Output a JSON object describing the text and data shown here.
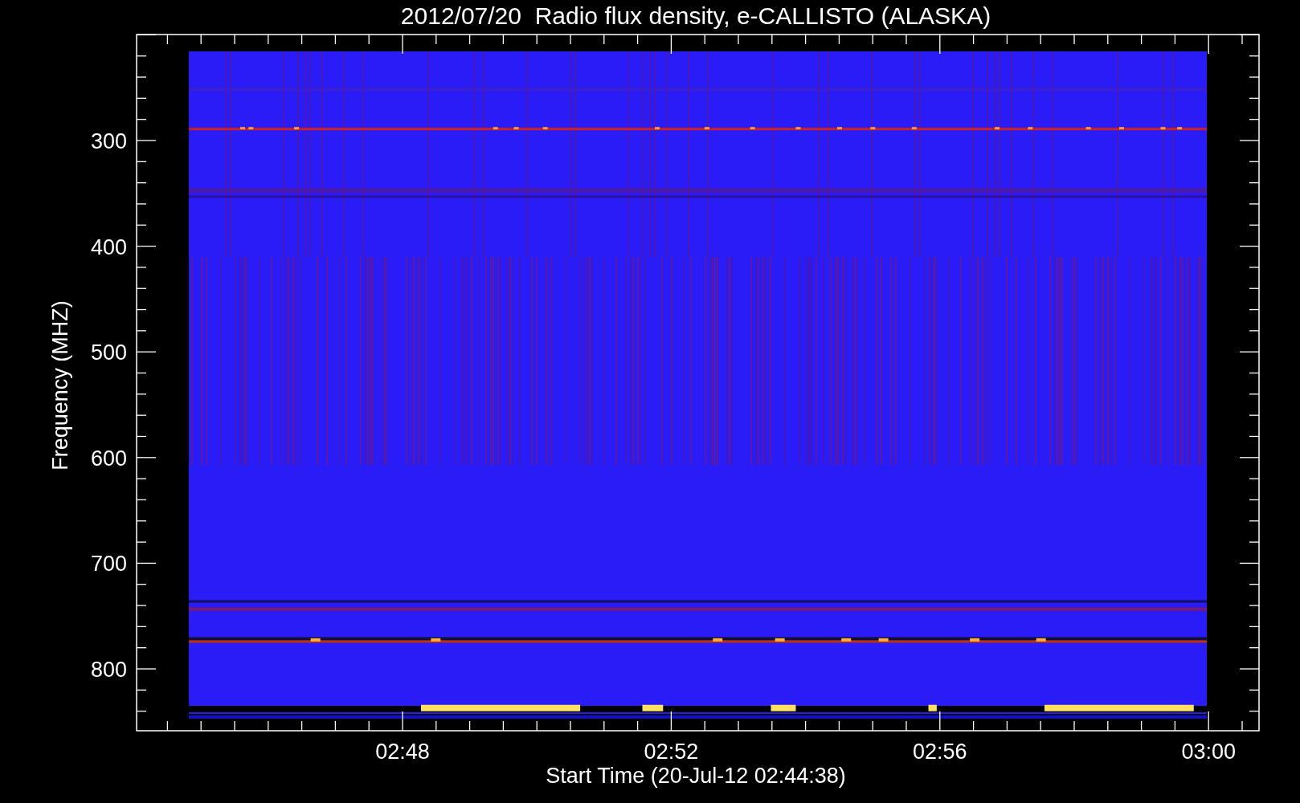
{
  "title": "2012/07/20  Radio flux density, e-CALLISTO (ALASKA)",
  "ylabel": "Frequency (MHZ)",
  "xlabel": "Start Time (20-Jul-12 02:44:38)",
  "yticks": [
    "300",
    "400",
    "500",
    "600",
    "700",
    "800"
  ],
  "xticks": [
    "02:48",
    "02:52",
    "02:56",
    "03:00"
  ]
}
